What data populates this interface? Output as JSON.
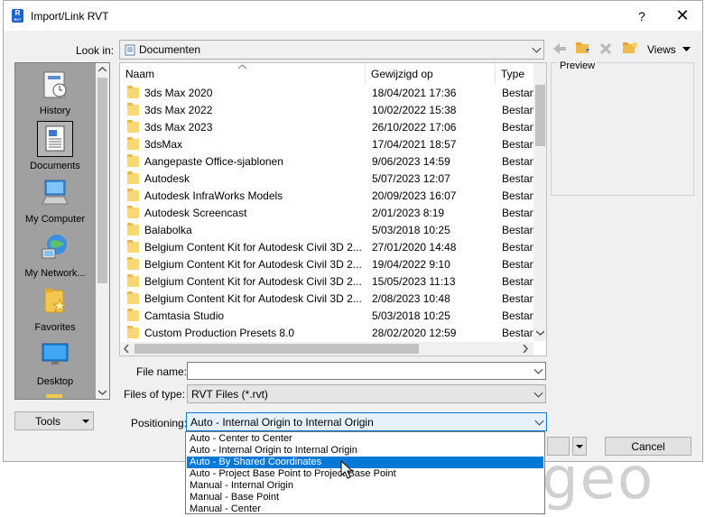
{
  "window": {
    "title": "Import/Link RVT",
    "help": "?",
    "close": "✕"
  },
  "look_in": {
    "label": "Look in:",
    "value": "Documenten",
    "views_label": "Views"
  },
  "places": [
    {
      "label": "History",
      "icon": "history-icon"
    },
    {
      "label": "Documents",
      "icon": "documents-icon"
    },
    {
      "label": "My Computer",
      "icon": "computer-icon"
    },
    {
      "label": "My Network...",
      "icon": "network-icon"
    },
    {
      "label": "Favorites",
      "icon": "favorites-icon"
    },
    {
      "label": "Desktop",
      "icon": "desktop-icon"
    }
  ],
  "files": {
    "headers": {
      "name": "Naam",
      "date": "Gewijzigd op",
      "type": "Type"
    },
    "rows": [
      {
        "name": "3ds Max 2020",
        "date": "18/04/2021 17:36",
        "type": "Bestan"
      },
      {
        "name": "3ds Max 2022",
        "date": "10/02/2022 15:38",
        "type": "Bestan"
      },
      {
        "name": "3ds Max 2023",
        "date": "26/10/2022 17:06",
        "type": "Bestan"
      },
      {
        "name": "3dsMax",
        "date": "17/04/2021 18:57",
        "type": "Bestan"
      },
      {
        "name": "Aangepaste Office-sjablonen",
        "date": "9/06/2023 14:59",
        "type": "Bestan"
      },
      {
        "name": "Autodesk",
        "date": "5/07/2023 12:07",
        "type": "Bestan"
      },
      {
        "name": "Autodesk InfraWorks Models",
        "date": "20/09/2023 16:07",
        "type": "Bestan"
      },
      {
        "name": "Autodesk Screencast",
        "date": "2/01/2023 8:19",
        "type": "Bestan"
      },
      {
        "name": "Balabolka",
        "date": "5/03/2018 10:25",
        "type": "Bestan"
      },
      {
        "name": "Belgium Content Kit for Autodesk Civil 3D 2...",
        "date": "27/01/2020 14:48",
        "type": "Bestan"
      },
      {
        "name": "Belgium Content Kit for Autodesk Civil 3D 2...",
        "date": "19/04/2022 9:10",
        "type": "Bestan"
      },
      {
        "name": "Belgium Content Kit for Autodesk Civil 3D 2...",
        "date": "15/05/2023 11:13",
        "type": "Bestan"
      },
      {
        "name": "Belgium Content Kit for Autodesk Civil 3D 2...",
        "date": "2/08/2023 10:48",
        "type": "Bestan"
      },
      {
        "name": "Camtasia Studio",
        "date": "5/03/2018 10:25",
        "type": "Bestan"
      },
      {
        "name": "Custom Production Presets 8.0",
        "date": "28/02/2020 12:59",
        "type": "Bestan"
      }
    ]
  },
  "preview": {
    "label": "Preview"
  },
  "file_name": {
    "label": "File name:",
    "value": ""
  },
  "files_of_type": {
    "label": "Files of type:",
    "value": "RVT Files  (*.rvt)"
  },
  "tools": {
    "label": "Tools"
  },
  "positioning": {
    "label": "Positioning:",
    "value": "Auto - Internal Origin to Internal Origin",
    "options": [
      "Auto - Center to Center",
      "Auto - Internal Origin to Internal Origin",
      "Auto - By Shared Coordinates",
      "Auto - Project Base Point to Project Base Point",
      "Manual - Internal Origin",
      "Manual - Base Point",
      "Manual - Center"
    ],
    "highlighted_index": 2
  },
  "buttons": {
    "cancel": "Cancel"
  },
  "watermark": "geo",
  "colors": {
    "highlight": "#0078d7",
    "folder": "#f8d775"
  }
}
